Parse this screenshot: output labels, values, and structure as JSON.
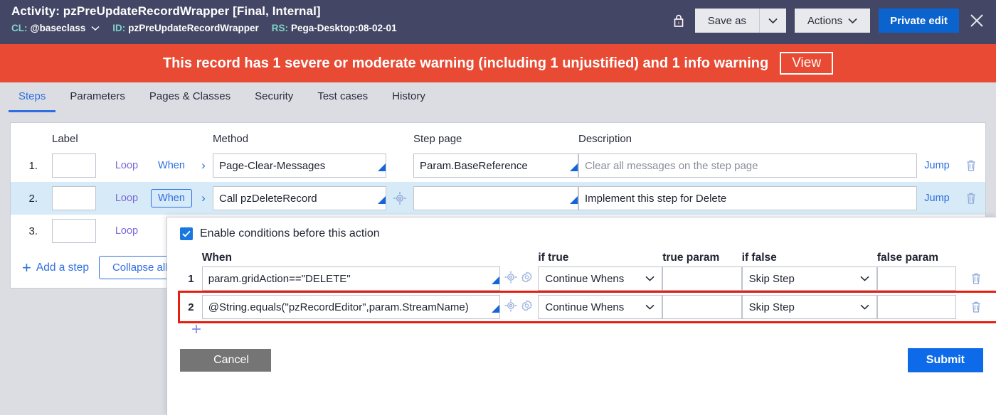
{
  "header": {
    "title": "Activity: pzPreUpdateRecordWrapper [Final, Internal]",
    "class_key": "CL:",
    "class_value": "@baseclass",
    "id_key": "ID:",
    "id_value": "pzPreUpdateRecordWrapper",
    "ruleset_key": "RS:",
    "ruleset_value": "Pega-Desktop:08-02-01",
    "lock_icon": "lock-icon",
    "save_as_label": "Save as",
    "actions_label": "Actions",
    "private_edit_label": "Private edit",
    "close_icon": "close-icon",
    "bg_color": "#434765",
    "accent_color": "#0b63ce"
  },
  "banner": {
    "message": "This record has 1 severe or moderate warning (including 1 unjustified) and 1 info warning",
    "view_label": "View",
    "color": "#e84a33"
  },
  "tabs": [
    {
      "label": "Steps",
      "active": true
    },
    {
      "label": "Parameters",
      "active": false
    },
    {
      "label": "Pages & Classes",
      "active": false
    },
    {
      "label": "Security",
      "active": false
    },
    {
      "label": "Test cases",
      "active": false
    },
    {
      "label": "History",
      "active": false
    }
  ],
  "steps_table": {
    "columns": {
      "label": "Label",
      "method": "Method",
      "step_page": "Step page",
      "description": "Description"
    },
    "loop_label": "Loop",
    "when_label": "When",
    "jump_label": "Jump",
    "chevron_icon": "chevron-right-icon",
    "target_icon": "target-icon",
    "delete_icon": "trash-icon",
    "rows": [
      {
        "num": "1.",
        "label_value": "",
        "method": "Page-Clear-Messages",
        "step_page": "Param.BaseReference",
        "description": "",
        "description_placeholder": "Clear all messages on the step page",
        "selected": false,
        "has_target_icon": false,
        "when_boxed": false
      },
      {
        "num": "2.",
        "label_value": "",
        "method": "Call pzDeleteRecord",
        "step_page": "",
        "description": "Implement this step for Delete",
        "description_placeholder": "",
        "selected": true,
        "has_target_icon": true,
        "when_boxed": true
      },
      {
        "num": "3.",
        "label_value": "",
        "method": "",
        "step_page": "",
        "description": "",
        "description_placeholder": "",
        "selected": false,
        "has_target_icon": false,
        "when_boxed": false
      }
    ],
    "add_step_label": "Add a step",
    "collapse_label": "Collapse all",
    "add_icon": "plus-icon"
  },
  "conditions_panel": {
    "enable_label": "Enable conditions before this action",
    "enable_checked": true,
    "check_icon": "check-icon",
    "columns": {
      "when": "When",
      "if_true": "if true",
      "true_param": "true param",
      "if_false": "if false",
      "false_param": "false param"
    },
    "rows": [
      {
        "num": "1",
        "when": "param.gridAction==\"DELETE\"",
        "if_true": "Continue Whens",
        "true_param": "",
        "if_false": "Skip Step",
        "false_param": "",
        "highlighted": false
      },
      {
        "num": "2",
        "when": "@String.equals(\"pzRecordEditor\",param.StreamName)",
        "if_true": "Continue Whens",
        "true_param": "",
        "if_false": "Skip Step",
        "false_param": "",
        "highlighted": true
      }
    ],
    "target_icon": "target-icon",
    "gear_icon": "gear-icon",
    "delete_icon": "trash-icon",
    "add_row_icon": "plus-icon",
    "cancel_label": "Cancel",
    "submit_label": "Submit",
    "highlight_color": "#e81e11"
  }
}
